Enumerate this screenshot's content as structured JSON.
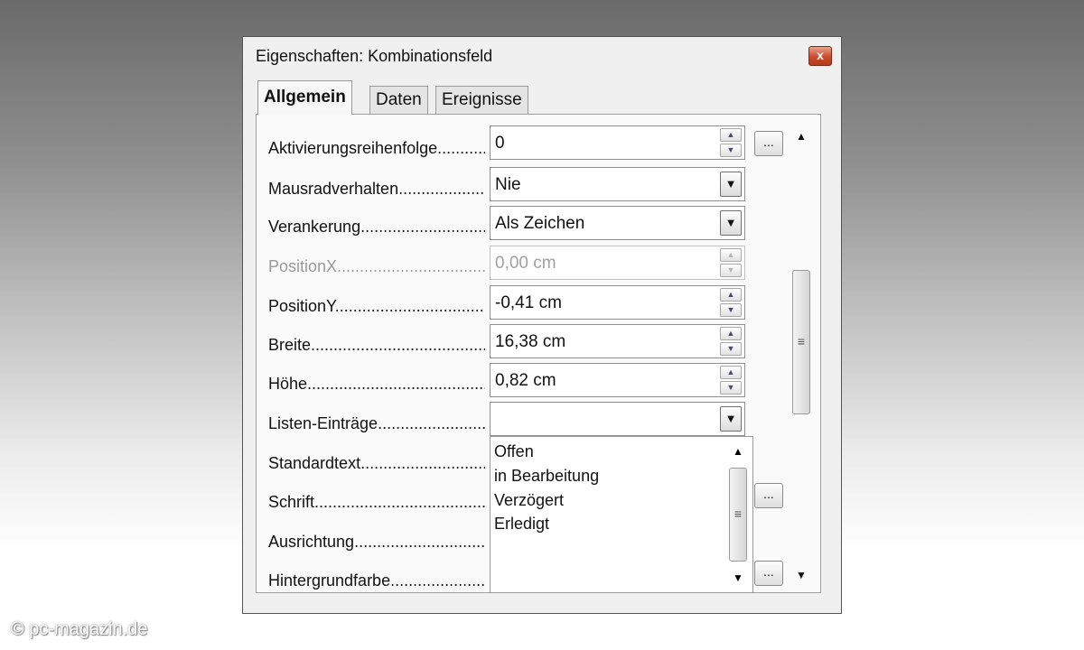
{
  "window": {
    "title": "Eigenschaften: Kombinationsfeld",
    "close_symbol": "x"
  },
  "tabs": [
    {
      "label": "Allgemein",
      "active": true
    },
    {
      "label": "Daten",
      "active": false
    },
    {
      "label": "Ereignisse",
      "active": false
    }
  ],
  "properties": [
    {
      "label": "Aktivierungsreihenfolge",
      "value": "0"
    },
    {
      "label": "Mausradverhalten",
      "value": "Nie"
    },
    {
      "label": "Verankerung",
      "value": "Als Zeichen"
    },
    {
      "label": "PositionX",
      "value": "0,00 cm"
    },
    {
      "label": "PositionY",
      "value": "-0,41 cm"
    },
    {
      "label": "Breite",
      "value": "16,38 cm"
    },
    {
      "label": "Höhe",
      "value": "0,82 cm"
    },
    {
      "label": "Listen-Einträge",
      "value": ""
    },
    {
      "label": "Standardtext"
    },
    {
      "label": "Schrift"
    },
    {
      "label": "Ausrichtung"
    },
    {
      "label": "Hintergrundfarbe"
    }
  ],
  "list_entries": [
    "Offen",
    "in Bearbeitung",
    "Verzögert",
    "Erledigt"
  ],
  "ellipsis_label": "...",
  "watermark": "© pc-magazin.de"
}
